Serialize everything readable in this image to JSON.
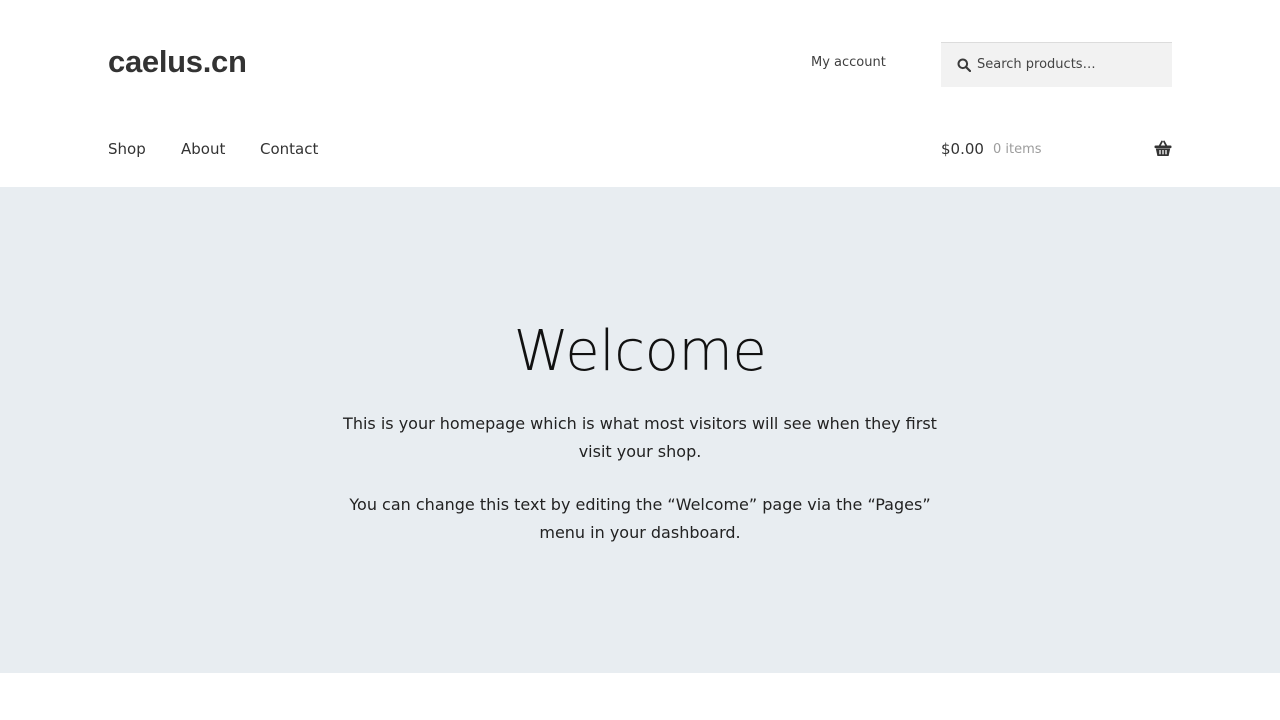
{
  "header": {
    "site_title": "caelus.cn",
    "account_link": "My account",
    "search": {
      "placeholder": "Search products…",
      "value": ""
    },
    "nav": [
      {
        "label": "Shop"
      },
      {
        "label": "About"
      },
      {
        "label": "Contact"
      }
    ],
    "cart": {
      "amount": "$0.00",
      "count": "0 items",
      "icon": "basket-icon"
    }
  },
  "hero": {
    "title": "Welcome",
    "paragraph_1": "This is your homepage which is what most visitors will see when they first visit your shop.",
    "paragraph_2": "You can change this text by editing the “Welcome” page via the “Pages” menu in your dashboard."
  },
  "colors": {
    "text": "#333333",
    "hero_background": "#e8edf1",
    "search_background": "#f2f2f2",
    "muted": "#9c9c9c"
  }
}
